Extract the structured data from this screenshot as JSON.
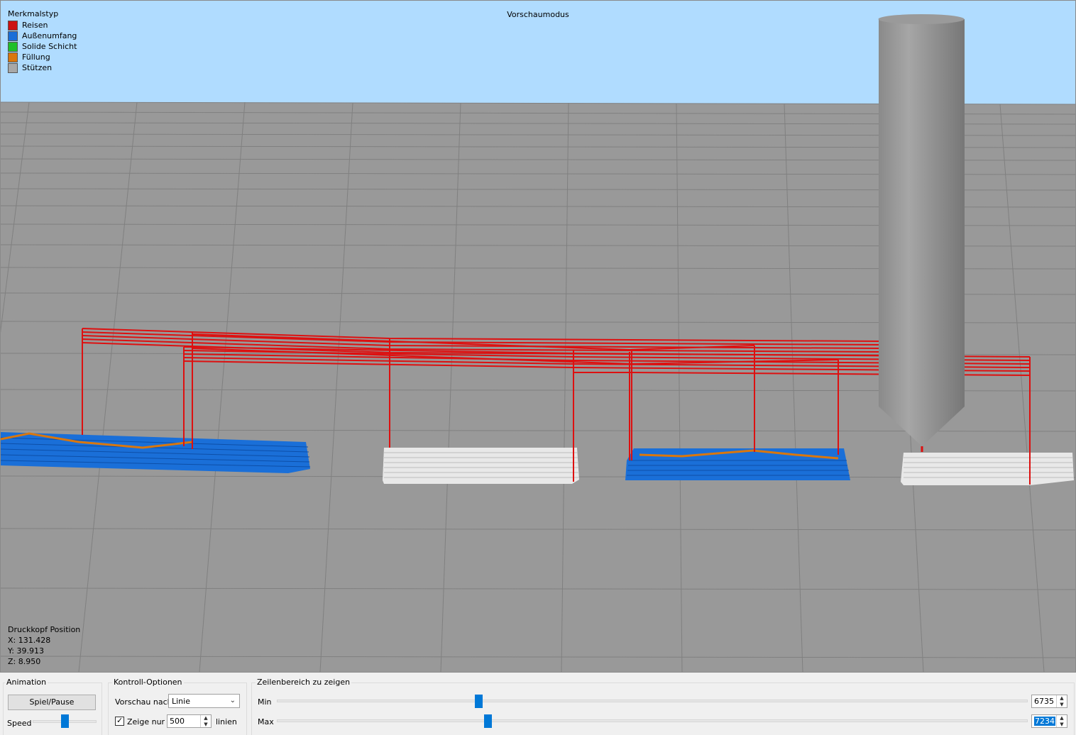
{
  "viewport": {
    "title": "Vorschaumodus",
    "sky_color": "#b0dcff",
    "bed_color": "#999999"
  },
  "legend": {
    "title": "Merkmalstyp",
    "items": [
      {
        "label": "Reisen",
        "color": "#cc1111"
      },
      {
        "label": "Außenumfang",
        "color": "#1a6fd8"
      },
      {
        "label": "Solide Schicht",
        "color": "#1fbf2a"
      },
      {
        "label": "Füllung",
        "color": "#d9770e"
      },
      {
        "label": "Stützen",
        "color": "#a8a8a8"
      }
    ]
  },
  "printhead": {
    "title": "Druckkopf Position",
    "x": "X: 131.428",
    "y": "Y: 39.913",
    "z": "Z: 8.950"
  },
  "animation": {
    "title": "Animation",
    "play_button": "Spiel/Pause",
    "speed_label": "Speed",
    "speed_fraction": 0.5
  },
  "controls": {
    "title": "Kontroll-Optionen",
    "preview_by_label": "Vorschau nach",
    "preview_by_value": "Linie",
    "show_only_label": "Zeige nur",
    "show_only_checked": true,
    "show_only_value": "500",
    "lines_label": "linien"
  },
  "range": {
    "title": "Zeilenbereich zu zeigen",
    "min_label": "Min",
    "max_label": "Max",
    "min_value": "6735",
    "max_value": "7234",
    "min_fraction": 0.266,
    "max_fraction": 0.279
  }
}
